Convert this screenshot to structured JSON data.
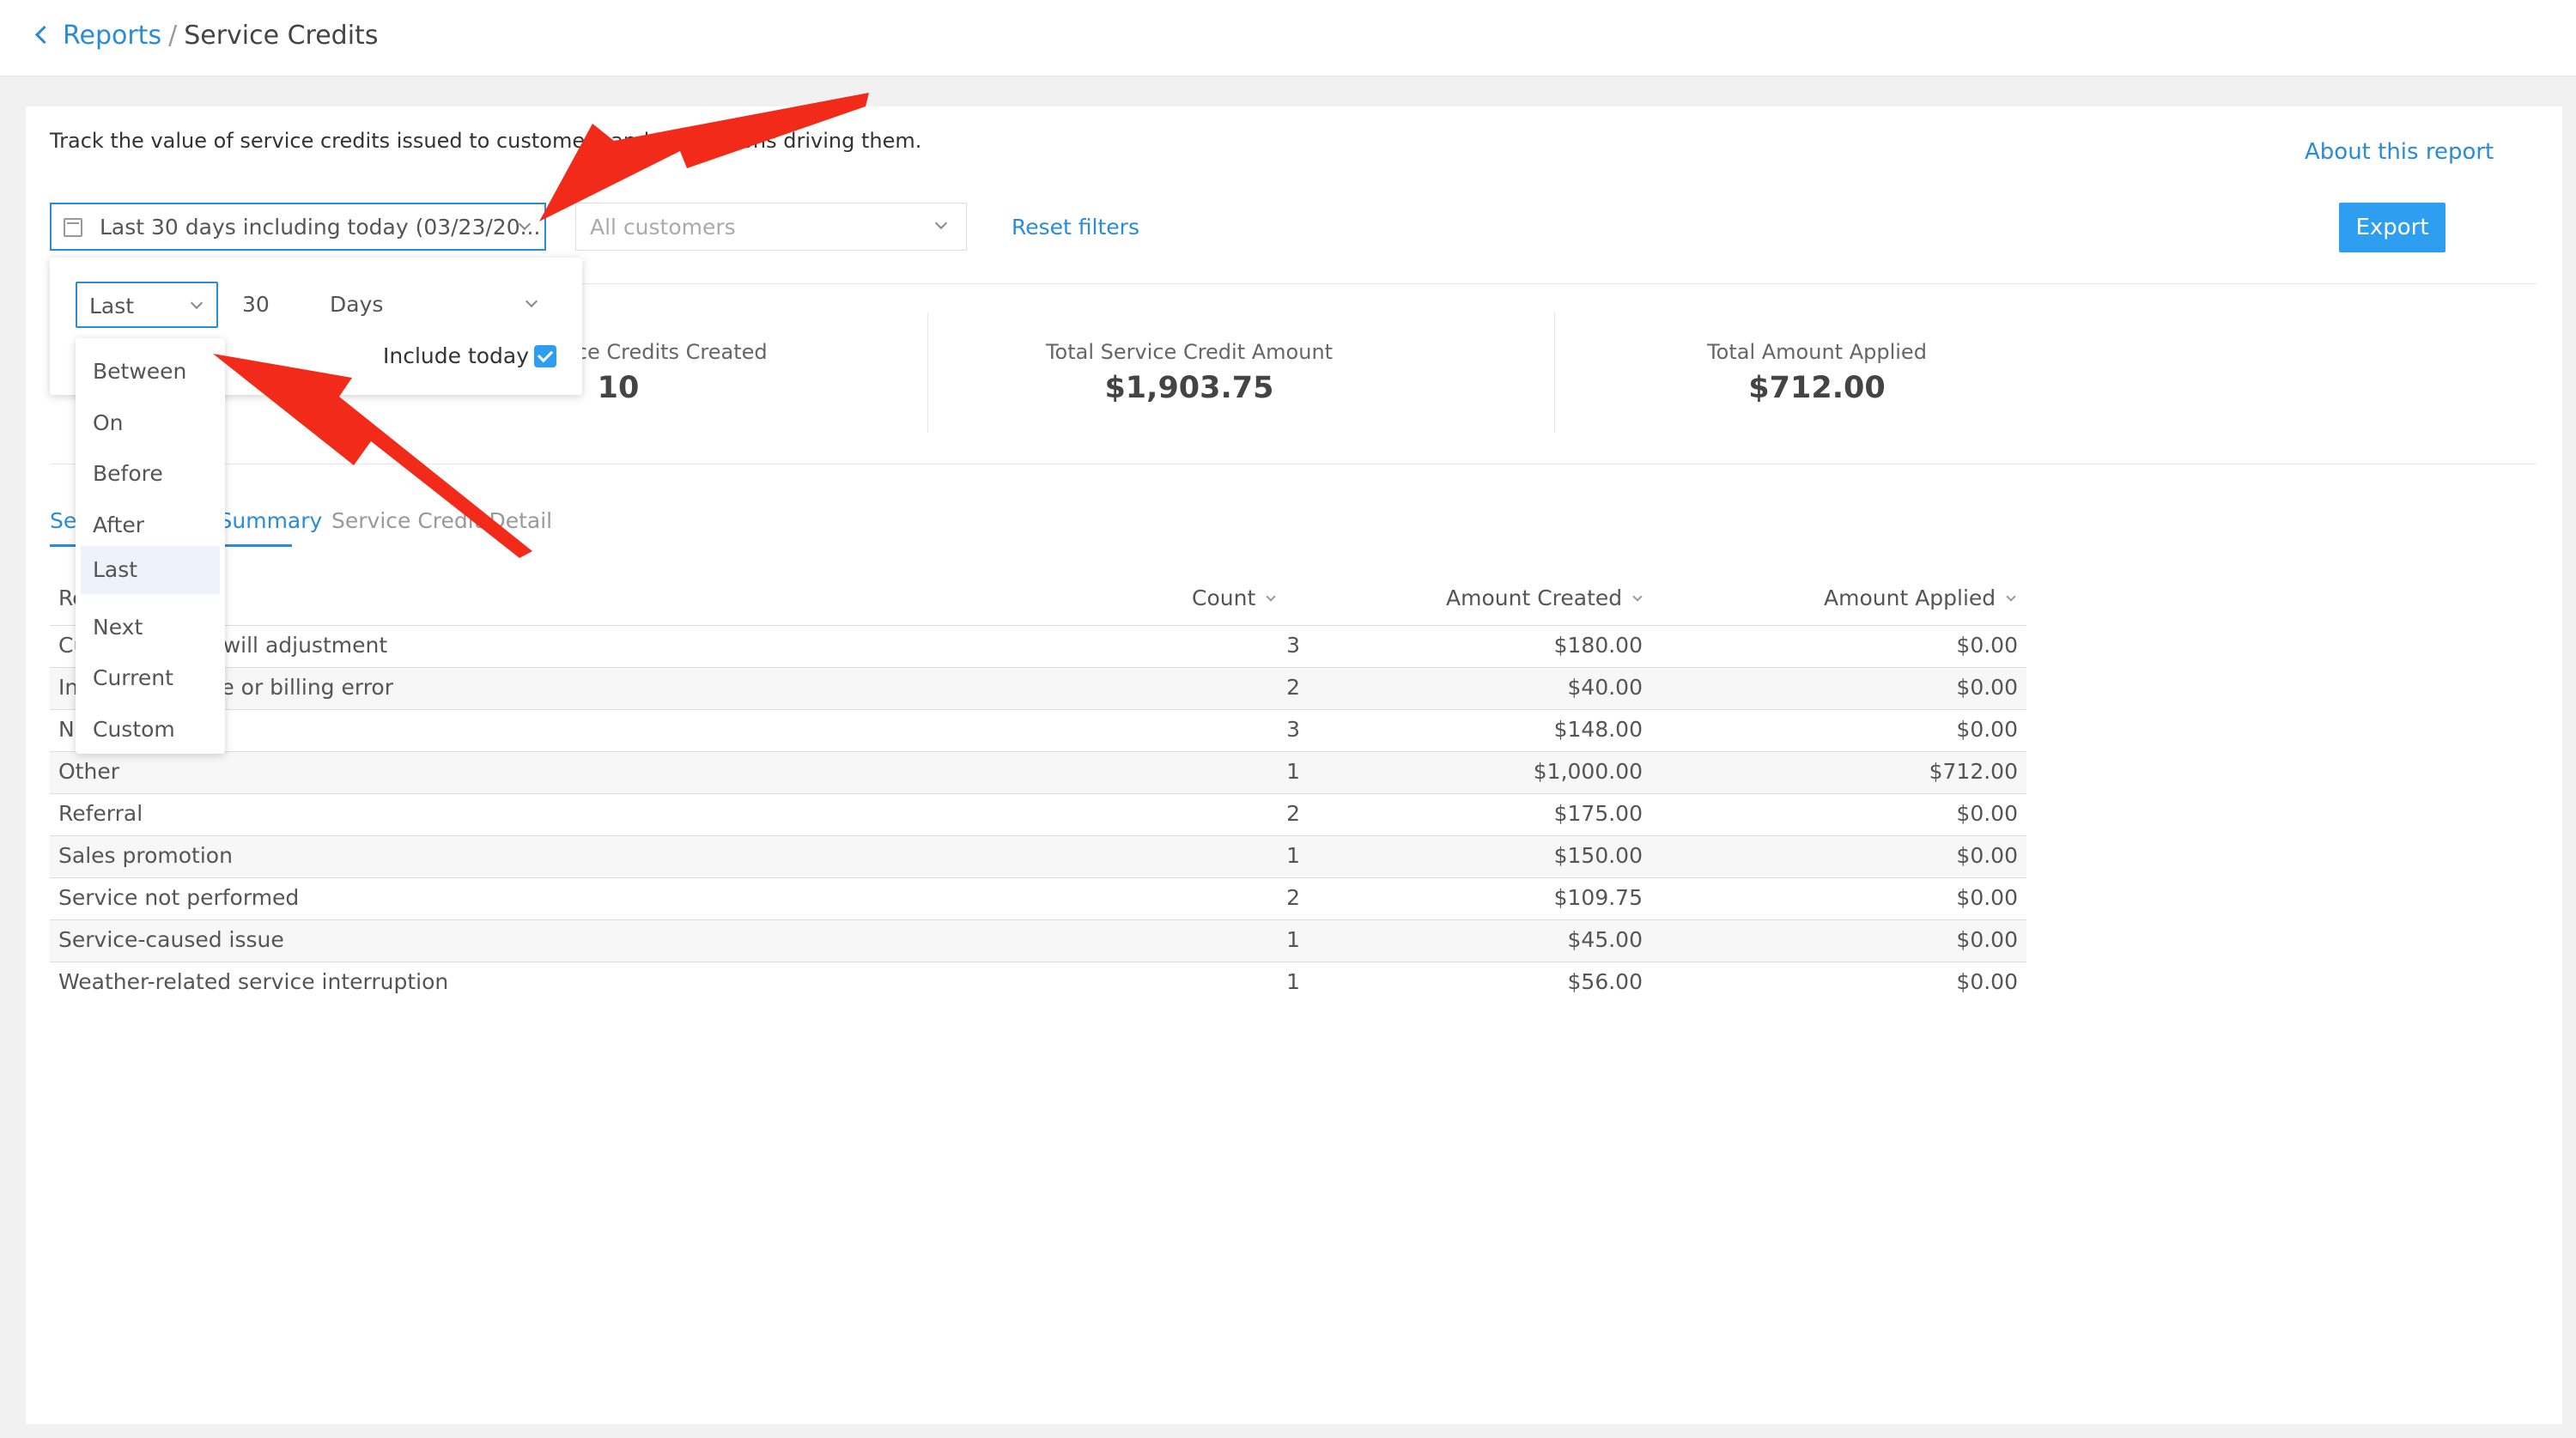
{
  "breadcrumb": {
    "parent": "Reports",
    "separator": "/",
    "current": "Service Credits"
  },
  "report": {
    "description": "Track the value of service credits issued to customers and the reasons driving them.",
    "about_link": "About this report"
  },
  "filters": {
    "date_range": "Last 30 days including today (03/23/20...",
    "customers_placeholder": "All customers",
    "reset": "Reset filters",
    "export": "Export"
  },
  "stats": [
    {
      "label": "Total Service Credits Created",
      "value": "10"
    },
    {
      "label": "Total Service Credit Amount",
      "value": "$1,903.75"
    },
    {
      "label": "Total Amount Applied",
      "value": "$712.00"
    }
  ],
  "tabs": [
    {
      "label": "Service Credits Summary",
      "active": true
    },
    {
      "label": "Service Credit Detail",
      "active": false
    }
  ],
  "table": {
    "headers": [
      "Reason",
      "Count",
      "Amount Created",
      "Amount Applied"
    ],
    "rows": [
      [
        "Customer goodwill adjustment",
        "3",
        "$180.00",
        "$0.00"
      ],
      [
        "Incorrect charge or billing error",
        "2",
        "$40.00",
        "$0.00"
      ],
      [
        "No-show",
        "3",
        "$148.00",
        "$0.00"
      ],
      [
        "Other",
        "1",
        "$1,000.00",
        "$712.00"
      ],
      [
        "Referral",
        "2",
        "$175.00",
        "$0.00"
      ],
      [
        "Sales promotion",
        "1",
        "$150.00",
        "$0.00"
      ],
      [
        "Service not performed",
        "2",
        "$109.75",
        "$0.00"
      ],
      [
        "Service-caused issue",
        "1",
        "$45.00",
        "$0.00"
      ],
      [
        "Weather-related service interruption",
        "1",
        "$56.00",
        "$0.00"
      ]
    ]
  },
  "date_popover": {
    "mode": "Last",
    "number": "30",
    "unit": "Days",
    "include_today_label": "Include today",
    "include_today_checked": true,
    "mode_options": [
      "Between",
      "On",
      "Before",
      "After",
      "Last",
      "Next",
      "Current",
      "Custom"
    ],
    "selected_option": "Last"
  },
  "colors": {
    "accent": "#2a8bd6",
    "export_bg": "#2e9ef0",
    "annotation_arrow": "#f22a1a"
  }
}
